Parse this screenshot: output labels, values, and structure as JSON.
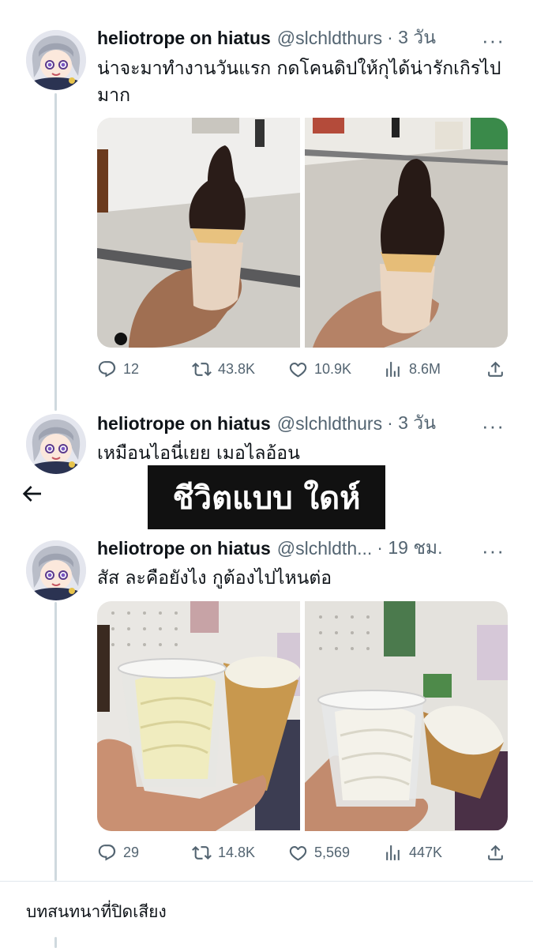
{
  "tweets": [
    {
      "name": "heliotrope on hiatus",
      "handle": "@slchldthurs",
      "time": "· 3 วัน",
      "more": "···",
      "text": "น่าจะมาทำงานวันแรก กดโคนดิปให้กุได้น่ารักเกิรไปมาก",
      "media": [
        "dipped-cone-photo-1",
        "dipped-cone-photo-2"
      ],
      "stats": {
        "replies": "12",
        "retweets": "43.8K",
        "likes": "10.9K",
        "views": "8.6M"
      }
    },
    {
      "name": "heliotrope on hiatus",
      "handle": "@slchldthurs",
      "time": "· 3 วัน",
      "more": "···",
      "text": "เหมือนไอนี่เยย เมอไลอ้อน"
    },
    {
      "name": "heliotrope on hiatus",
      "handle": "@slchldth...",
      "time": "· 19 ชม.",
      "more": "···",
      "text": "สัส ละคือยังไง กูต้องไปไหนต่อ",
      "media": [
        "cup-and-cone-photo-1",
        "cup-and-cone-photo-2"
      ],
      "stats": {
        "replies": "29",
        "retweets": "14.8K",
        "likes": "5,569",
        "views": "447K"
      }
    }
  ],
  "overlay_caption": "ชีวิตแบบ ใดห์",
  "muted_section": "บทสนทนาที่ปิดเสียง",
  "colors": {
    "text": "#0f1419",
    "secondary": "#536471",
    "thread": "#cfd9de",
    "overlay_bg": "#111111"
  }
}
